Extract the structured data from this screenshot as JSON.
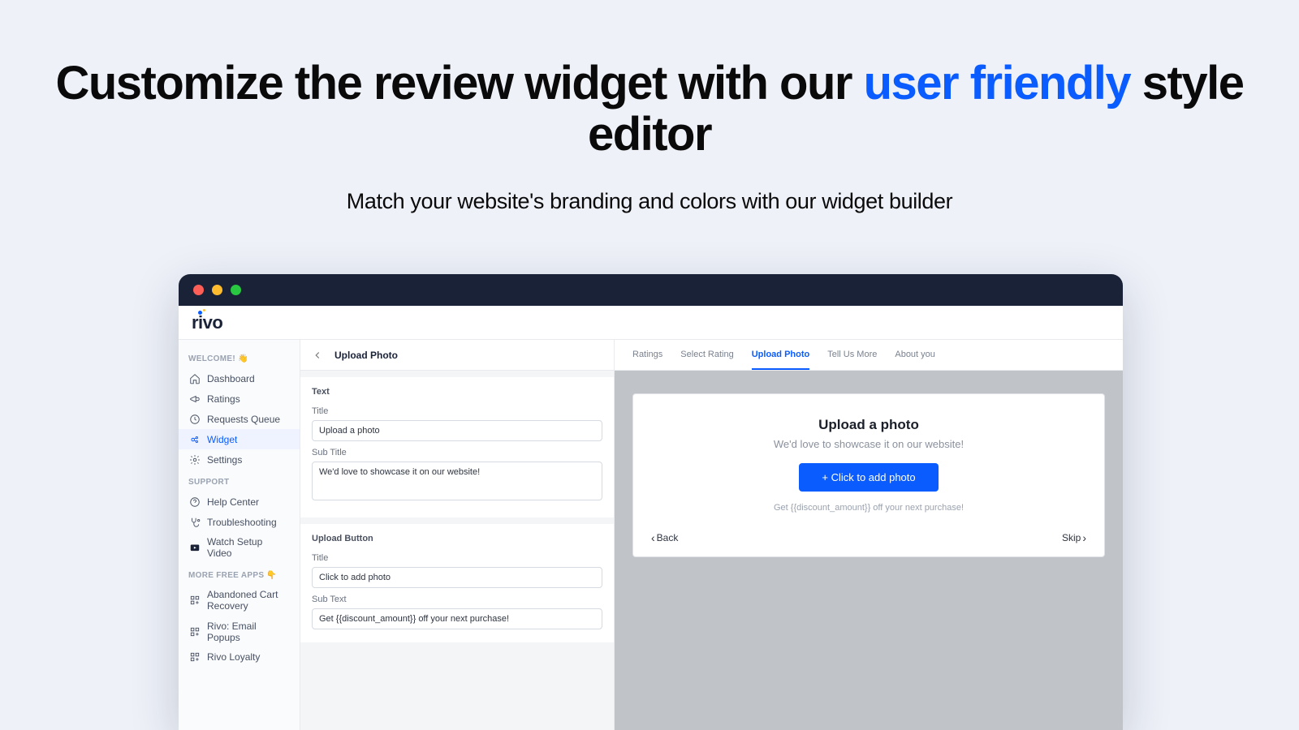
{
  "hero": {
    "headline_pre": "Customize the review widget with our ",
    "headline_highlight": "user friendly",
    "headline_post": " style editor",
    "subhead": "Match your website's branding and colors with our widget builder"
  },
  "brand": "rivo",
  "sidebar": {
    "welcome_head": "WELCOME! 👋",
    "items_main": [
      {
        "label": "Dashboard"
      },
      {
        "label": "Ratings"
      },
      {
        "label": "Requests Queue"
      },
      {
        "label": "Widget"
      },
      {
        "label": "Settings"
      }
    ],
    "support_head": "SUPPORT",
    "items_support": [
      {
        "label": "Help Center"
      },
      {
        "label": "Troubleshooting"
      },
      {
        "label": "Watch Setup Video"
      }
    ],
    "more_head": "MORE FREE APPS 👇",
    "items_more": [
      {
        "label": "Abandoned Cart Recovery"
      },
      {
        "label": "Rivo: Email Popups"
      },
      {
        "label": "Rivo Loyalty"
      }
    ]
  },
  "editor": {
    "header": "Upload Photo",
    "section1": {
      "title": "Text",
      "field1_label": "Title",
      "field1_value": "Upload a photo",
      "field2_label": "Sub Title",
      "field2_value": "We'd love to showcase it on our website!"
    },
    "section2": {
      "title": "Upload Button",
      "field1_label": "Title",
      "field1_value": "Click to add photo",
      "field2_label": "Sub Text",
      "field2_value": "Get {{discount_amount}} off your next purchase!"
    }
  },
  "preview": {
    "tabs": [
      "Ratings",
      "Select Rating",
      "Upload Photo",
      "Tell Us More",
      "About you"
    ],
    "active_tab": "Upload Photo",
    "widget": {
      "title": "Upload a photo",
      "sub": "We'd love to showcase it on our website!",
      "button": "+ Click to add photo",
      "foot": "Get {{discount_amount}} off your next purchase!",
      "back": "Back",
      "skip": "Skip"
    }
  }
}
